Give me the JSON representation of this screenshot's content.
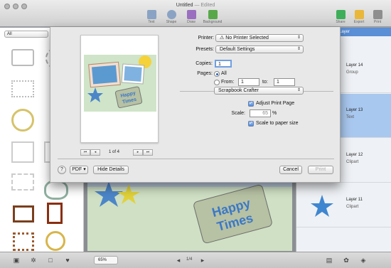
{
  "window": {
    "title": "Untitled",
    "edited": "— Edited"
  },
  "toolbar": {
    "text": "Text",
    "shape": "Shape",
    "draw": "Draw",
    "background": "Background",
    "share": "Share",
    "export": "Export",
    "print": "Print"
  },
  "sidebar": {
    "filter": "All"
  },
  "layers_panel": {
    "header": "Layer",
    "layers": [
      {
        "name": "Layer 14",
        "type": "Group"
      },
      {
        "name": "Layer 13",
        "type": "Text"
      },
      {
        "name": "Layer 12",
        "type": "Clipart"
      },
      {
        "name": "Layer 11",
        "type": "Clipart"
      }
    ]
  },
  "canvas_art": {
    "line1": "Happy",
    "line2": "Times"
  },
  "bottom": {
    "zoom": "65%",
    "page": "1/4"
  },
  "print_dialog": {
    "printer_label": "Printer:",
    "printer_value": "⚠ No Printer Selected",
    "presets_label": "Presets:",
    "presets_value": "Default Settings",
    "copies_label": "Copies:",
    "copies_value": "1",
    "pages_label": "Pages:",
    "pages_all": "All",
    "pages_from": "From:",
    "from_value": "1",
    "to_label": "to:",
    "to_value": "1",
    "section_value": "Scrapbook Crafter",
    "adjust_label": "Adjust Print Page",
    "scale_label": "Scale:",
    "scale_value": "65",
    "scale_unit": "%",
    "scale_to_paper": "Scale to paper size",
    "preview_count": "1 of 4",
    "preview_art": {
      "line1": "Happy",
      "line2": "Times"
    },
    "pdf_label": "PDF",
    "hide_details": "Hide Details",
    "cancel": "Cancel",
    "print": "Print",
    "help": "?"
  }
}
